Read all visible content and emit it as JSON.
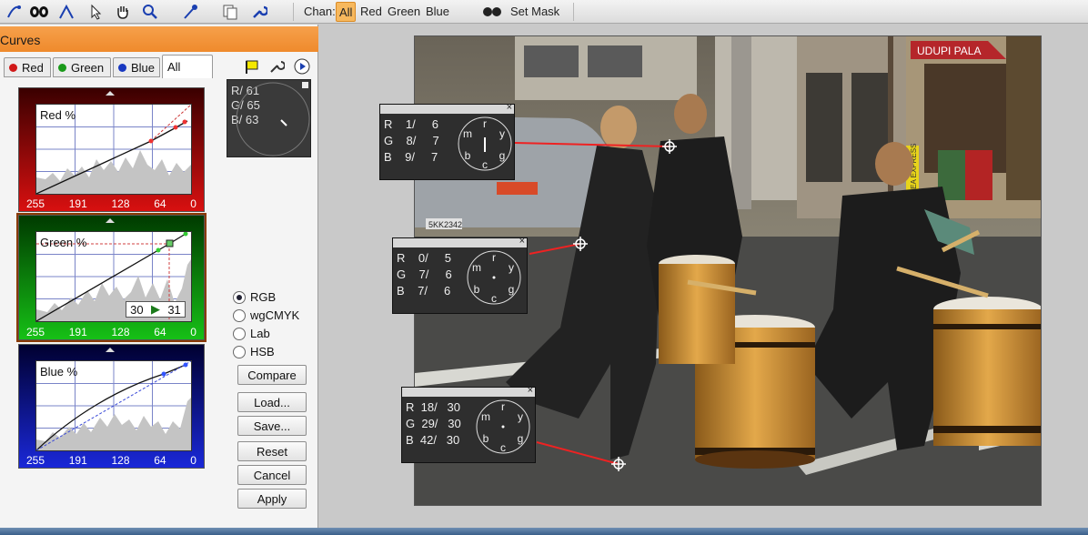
{
  "toolbar": {
    "chan_label": "Chan:",
    "channels": [
      "All",
      "Red",
      "Green",
      "Blue"
    ],
    "active_channel": "All",
    "set_mask_label": "Set Mask",
    "icons": [
      "eyedropper-curve-icon",
      "mask-icon",
      "pen-icon",
      "arrow-icon",
      "hand-icon",
      "zoom-icon",
      "picker-icon",
      "copy-icon",
      "wrench-icon"
    ]
  },
  "panel": {
    "title": "Curves",
    "tabs": [
      "Red",
      "Green",
      "Blue",
      "All"
    ],
    "curves": [
      {
        "label": "Red %",
        "bg": "#c01010",
        "ticks": [
          "255",
          "191",
          "128",
          "64",
          "0"
        ]
      },
      {
        "label": "Green %",
        "bg": "#12a012",
        "ticks": [
          "255",
          "191",
          "128",
          "64",
          "0"
        ],
        "point_in": "30",
        "point_out": "31"
      },
      {
        "label": "Blue %",
        "bg": "#1020b0",
        "ticks": [
          "255",
          "191",
          "128",
          "64",
          "0"
        ]
      }
    ],
    "readout": {
      "r": "R/   61",
      "g": "G/   65",
      "b": "B/   63"
    },
    "color_modes": [
      "RGB",
      "wgCMYK",
      "Lab",
      "HSB"
    ],
    "selected_mode": "RGB",
    "buttons": {
      "compare": "Compare",
      "load": "Load...",
      "save": "Save...",
      "reset": "Reset",
      "cancel": "Cancel",
      "apply": "Apply"
    }
  },
  "samplers": [
    {
      "r": "R    1/     6",
      "g": "G    8/     7",
      "b": "B    9/     7"
    },
    {
      "r": "R    0/     5",
      "g": "G    7/     6",
      "b": "B    7/     6"
    },
    {
      "r": "R  18/   30",
      "g": "G  29/   30",
      "b": "B  42/   30"
    }
  ],
  "dial_letters": [
    "r",
    "y",
    "g",
    "c",
    "b",
    "m"
  ],
  "photo": {
    "sign1": "UDUPI PALA",
    "sign2": "BAY AREA EXPRESS",
    "plate": "5KK2342"
  }
}
